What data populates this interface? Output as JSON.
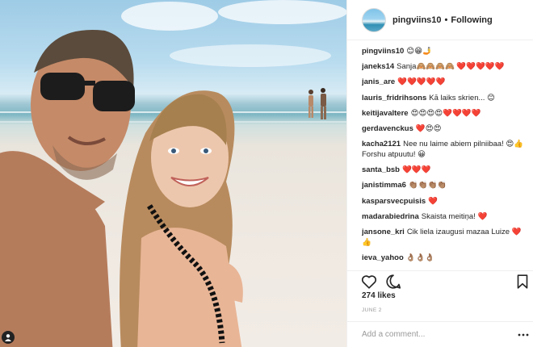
{
  "header": {
    "username": "pingviins10",
    "separator": "•",
    "follow_status": "Following"
  },
  "comments": [
    {
      "user": "pingviins10",
      "text": "😊😁🤳"
    },
    {
      "user": "janeks14",
      "text": "Sanja🙈🙈🙈🙈 ❤️❤️❤️❤️❤️"
    },
    {
      "user": "janis_are",
      "text": "❤️❤️❤️❤️❤️"
    },
    {
      "user": "lauris_fridrihsons",
      "text": "Kā laiks skrien... 😊"
    },
    {
      "user": "keitijavaltere",
      "text": "😍😍😍😍❤️❤️❤️❤️"
    },
    {
      "user": "gerdavenckus",
      "text": "❤️😍😍"
    },
    {
      "user": "kacha2121",
      "text": "Nee nu laime abiem pilniibaa! 😍👍 Forshu atpuutu! 😀"
    },
    {
      "user": "santa_bsb",
      "text": "❤️❤️❤️"
    },
    {
      "user": "janistimma6",
      "text": "👏🏽👏🏽👏🏽👏🏽"
    },
    {
      "user": "kasparsvecpuisis",
      "text": "❤️"
    },
    {
      "user": "madarabiedrina",
      "text": "Skaista meitiņa! ❤️"
    },
    {
      "user": "jansone_kri",
      "text": "Cik liela izaugusi mazaa Luize ❤️👍"
    },
    {
      "user": "ieva_yahoo",
      "text": "👌🏽👌🏽👌🏽"
    }
  ],
  "actions": {
    "like_icon": "heart-outline-icon",
    "comment_icon": "comment-bubble-icon",
    "save_icon": "bookmark-icon"
  },
  "likes": "274 likes",
  "date": "JUNE 2",
  "add_comment": {
    "placeholder": "Add a comment...",
    "more_icon": "ellipsis-icon"
  },
  "colors": {
    "text": "#262626",
    "muted": "#999999",
    "border": "#efefef",
    "heart": "#ed4956"
  }
}
